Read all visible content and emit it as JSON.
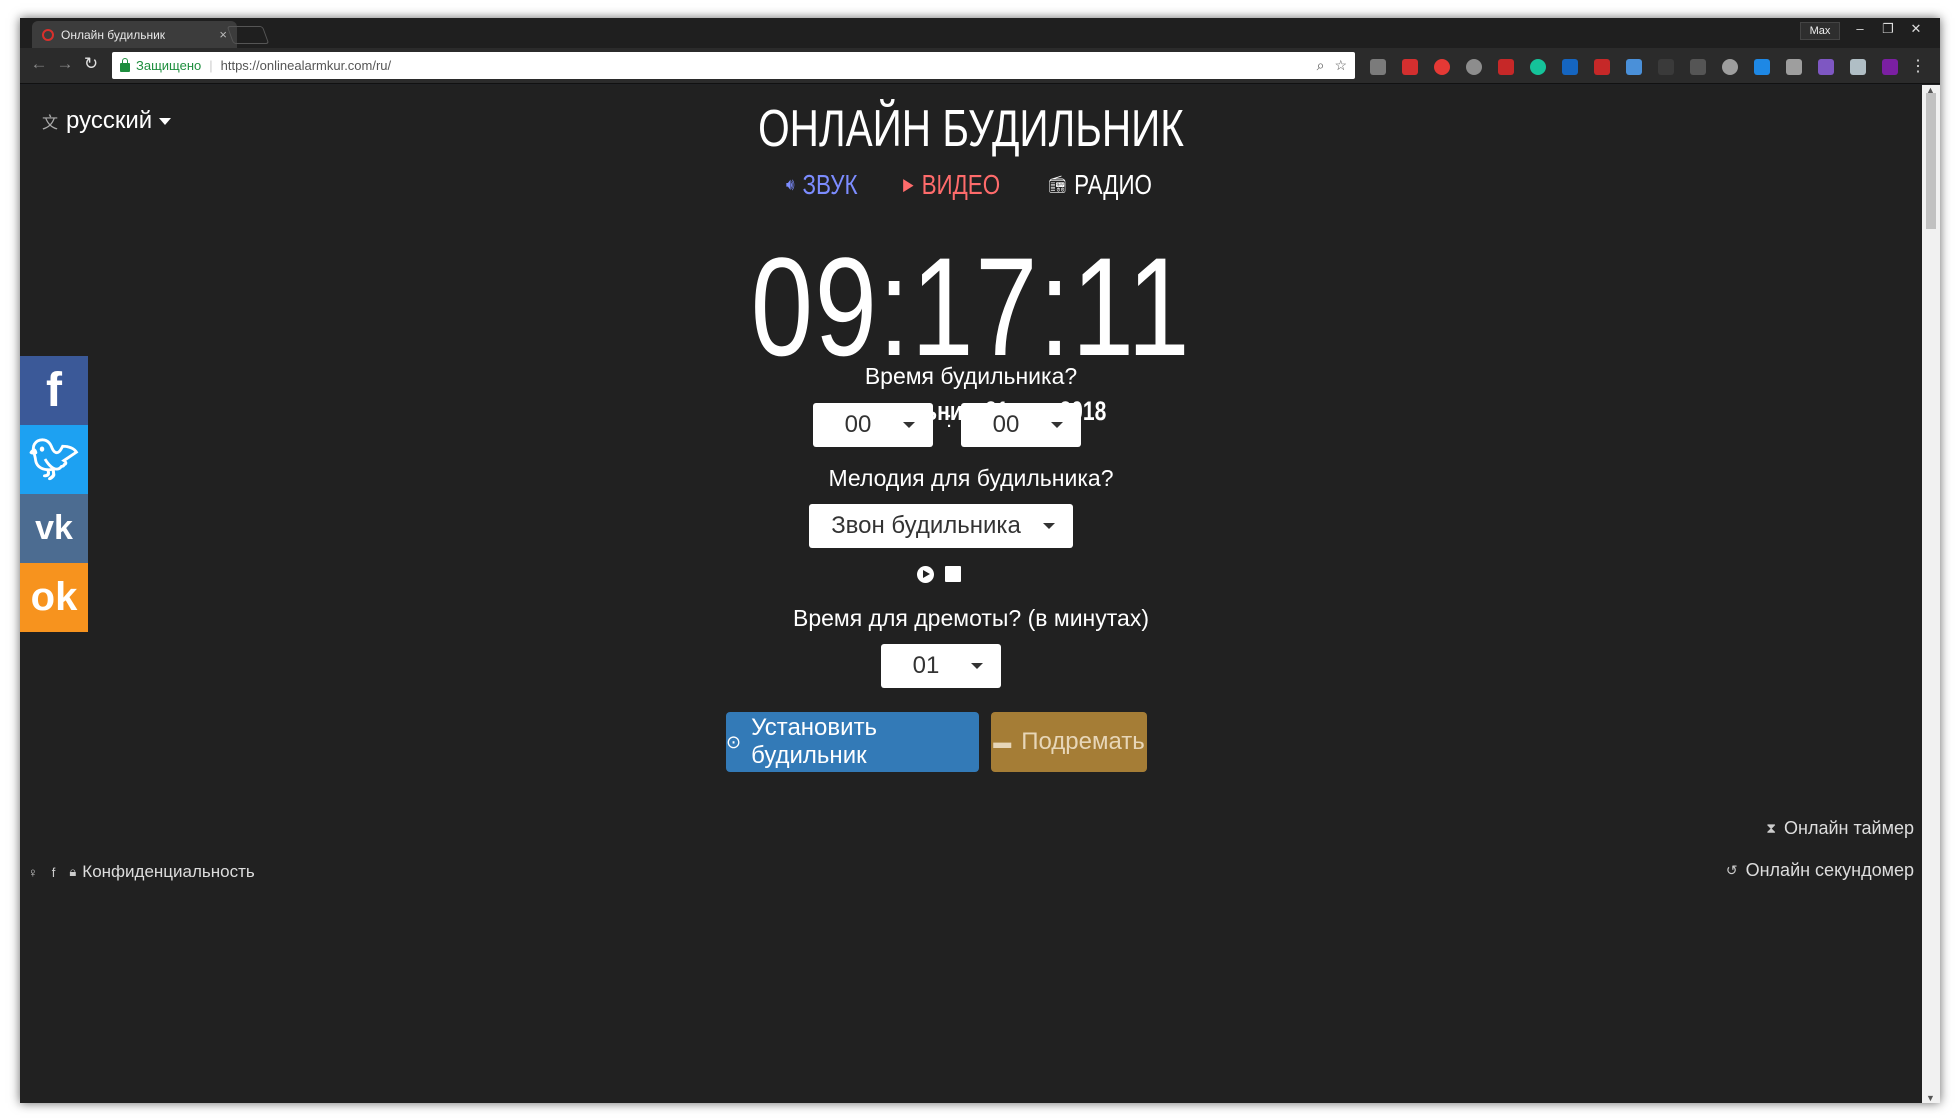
{
  "browser": {
    "tab_title": "Онлайн будильник",
    "tab_close": "×",
    "profile": "Max",
    "security_label": "Защищено",
    "url": "https://onlinealarmkur.com/ru/"
  },
  "page": {
    "language": "русский",
    "title": "ОНЛАЙН БУДИЛЬНИК",
    "modes": {
      "sound": "ЗВУК",
      "video": "ВИДЕО",
      "radio": "РАДИО"
    },
    "clock": "09:17:11",
    "date": "понедельник, 21 мая 2018",
    "alarm_time_label": "Время будильника?",
    "hour_value": "00",
    "minute_value": "00",
    "time_separator": ":",
    "melody_label": "Мелодия для будильника?",
    "melody_value": "Звон будильника",
    "snooze_label": "Время для дремоты? (в минутах)",
    "snooze_value": "01",
    "set_alarm_button": "Установить будильник",
    "snooze_button": "Подремать"
  },
  "footer": {
    "privacy": "Конфиденциальность",
    "timer_link": "Онлайн таймер",
    "stopwatch_link": "Онлайн секундомер"
  },
  "colors": {
    "background": "#212121",
    "primary_button": "#337ab7",
    "snooze_button": "#a57d36",
    "sound_mode": "#7c8cff",
    "video_mode": "#ff6b6b"
  }
}
